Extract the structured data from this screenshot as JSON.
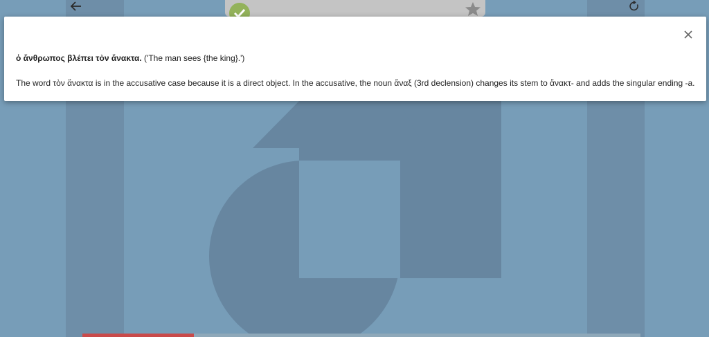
{
  "app": {
    "back_icon": "arrow-left-icon",
    "refresh_icon": "refresh-icon",
    "check_icon": "check-icon",
    "star_icon": "star-icon",
    "progress_fraction": 0.2
  },
  "modal": {
    "close_icon": "close-icon",
    "sentence_greek": "ὁ ἄνθρωπος βλέπει τὸν ἄνακτα.",
    "sentence_translation": "('The man sees {the king}.')",
    "explanation": "The word τὸν ἄνακτα is in the accusative case because it is a direct object. In the accusative, the noun ἄναξ (3rd declension) changes its stem to ἄνακτ- and adds the singular ending -a."
  },
  "colors": {
    "background": "#779db8",
    "shape_dark": "#6786a0",
    "accent_green": "#93b25a",
    "progress_red": "#c94a4a"
  }
}
